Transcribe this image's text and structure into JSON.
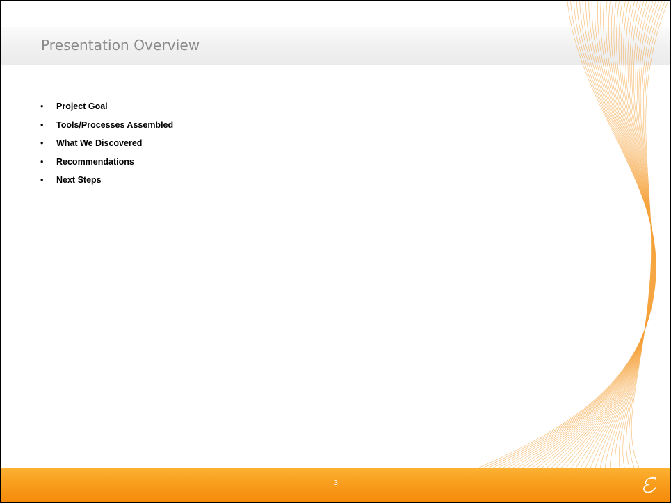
{
  "slide": {
    "title": "Presentation Overview",
    "bullet_marker": "•",
    "bullets": [
      "Project Goal",
      "Tools/Processes Assembled",
      "What We Discovered",
      "Recommendations",
      "Next Steps"
    ],
    "page_number": "3"
  },
  "colors": {
    "title_text": "#8a8a8a",
    "footer_orange": "#f9a020",
    "swirl_line": "#f5a23a"
  },
  "icons": {
    "logo": "script-e-logo"
  }
}
